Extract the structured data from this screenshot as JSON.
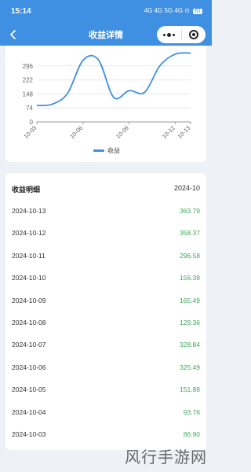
{
  "status_bar": {
    "time": "15:14",
    "signal_text": "4G 4G 5G 4G ⊙",
    "battery": "61"
  },
  "nav": {
    "title": "收益详情",
    "back_icon": "chevron-left-icon",
    "more_icon": "more-dots-icon",
    "close_icon": "target-close-icon"
  },
  "chart_data": {
    "type": "line",
    "y_ticks": [
      "0",
      "74",
      "148",
      "222",
      "296"
    ],
    "x_ticks": [
      "10-03",
      "10-06",
      "10-09",
      "10-12",
      "10-13"
    ],
    "x": [
      "10-03",
      "10-04",
      "10-05",
      "10-06",
      "10-07",
      "10-08",
      "10-09",
      "10-10",
      "10-11",
      "10-12",
      "10-13"
    ],
    "series": [
      {
        "name": "收益",
        "values": [
          86.9,
          93.76,
          151.88,
          325.49,
          328.84,
          129.36,
          165.49,
          156.38,
          296.58,
          358.37,
          363.79
        ]
      }
    ],
    "ylim": [
      0,
      370
    ],
    "grid": true,
    "legend_position": "bottom",
    "line_color": "#3f8fe3"
  },
  "detail": {
    "title": "收益明细",
    "month": "2024-10",
    "rows": [
      {
        "date": "2024-10-13",
        "amount": "363.79"
      },
      {
        "date": "2024-10-12",
        "amount": "358.37"
      },
      {
        "date": "2024-10-11",
        "amount": "296.58"
      },
      {
        "date": "2024-10-10",
        "amount": "156.38"
      },
      {
        "date": "2024-10-09",
        "amount": "165.49"
      },
      {
        "date": "2024-10-08",
        "amount": "129.36"
      },
      {
        "date": "2024-10-07",
        "amount": "328.84"
      },
      {
        "date": "2024-10-06",
        "amount": "325.49"
      },
      {
        "date": "2024-10-05",
        "amount": "151.88"
      },
      {
        "date": "2024-10-04",
        "amount": "93.76"
      },
      {
        "date": "2024-10-03",
        "amount": "86.90"
      }
    ]
  },
  "watermark": "风行手游网",
  "colors": {
    "accent": "#3f8fe3",
    "positive": "#3fa85a"
  }
}
